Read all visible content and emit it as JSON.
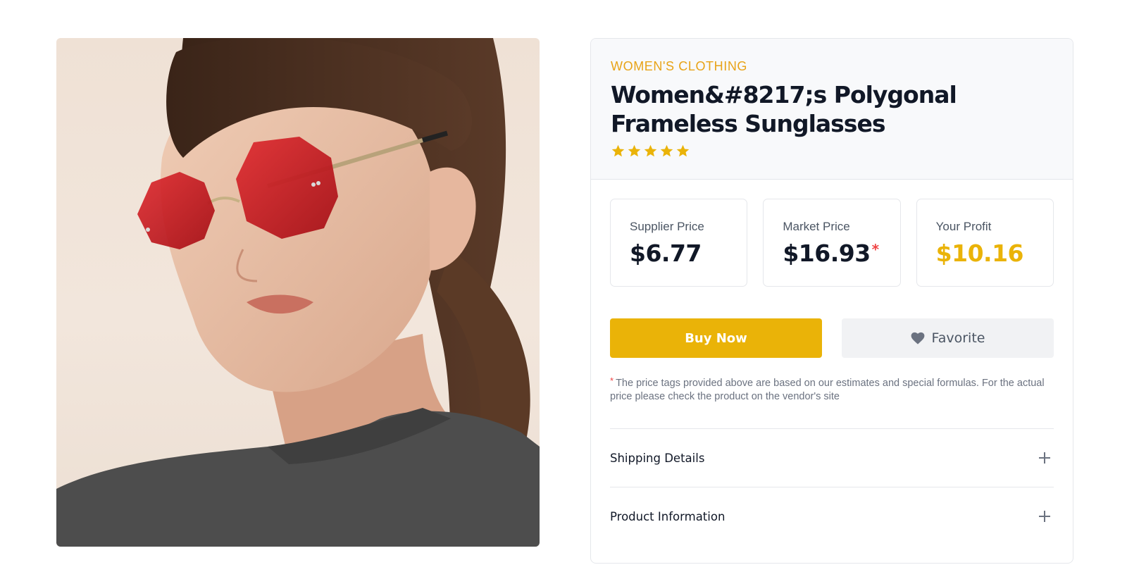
{
  "product": {
    "category": "WOMEN'S CLOTHING",
    "title": "Women&#8217;s Polygonal Frameless Sunglasses",
    "rating": 5,
    "rating_max": 5,
    "image_icon": "product-photo"
  },
  "prices": [
    {
      "label": "Supplier Price",
      "value": "$6.77",
      "asterisk": ""
    },
    {
      "label": "Market Price",
      "value": "$16.93",
      "asterisk": "*"
    },
    {
      "label": "Your Profit",
      "value": "$10.16",
      "asterisk": ""
    }
  ],
  "actions": {
    "buy_label": "Buy Now",
    "favorite_label": "Favorite",
    "favorite_icon": "heart-icon"
  },
  "disclaimer": {
    "asterisk": "*",
    "text": "The price tags provided above are based on our estimates and special formulas. For the actual price please check the product on the vendor's site"
  },
  "accordion": [
    {
      "title": "Shipping Details",
      "icon": "plus-icon"
    },
    {
      "title": "Product Information",
      "icon": "plus-icon"
    }
  ],
  "colors": {
    "accent": "#eab308",
    "category": "#e8a317",
    "asterisk": "#ef4444",
    "text_dark": "#111827",
    "text_muted": "#6b7280",
    "lens_red": "#c8141c"
  }
}
